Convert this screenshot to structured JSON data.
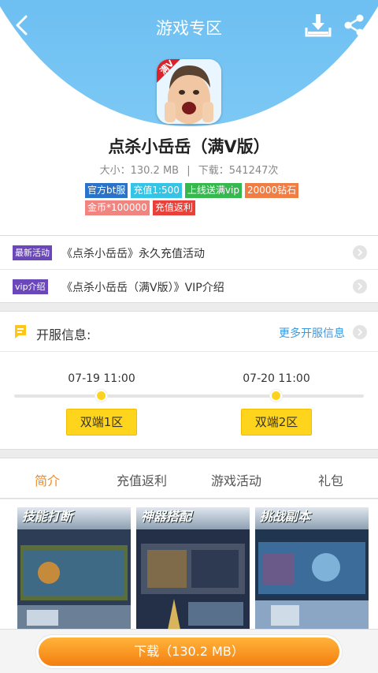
{
  "topbar": {
    "title": "游戏专区"
  },
  "app": {
    "name": "点杀小岳岳（满V版）",
    "size_text": "大小：130.2 MB",
    "separator": "|",
    "downloads_text": "下载：541247次",
    "icon_badge": "满V",
    "tags": [
      {
        "label": "官方bt服",
        "color": "#2a73c9"
      },
      {
        "label": "充值1:500",
        "color": "#35c3e6"
      },
      {
        "label": "上线送满vip",
        "color": "#35b84d"
      },
      {
        "label": "20000钻石",
        "color": "#f07d43"
      },
      {
        "label": "金币*100000",
        "color": "#f2847f"
      },
      {
        "label": "充值返利",
        "color": "#e8413a"
      }
    ]
  },
  "activities": [
    {
      "badge": "最新活动",
      "text": "《点杀小岳岳》永久充值活动"
    },
    {
      "badge": "vip介绍",
      "text": "《点杀小岳岳（满V版）》VIP介绍"
    }
  ],
  "server": {
    "title": "开服信息:",
    "more": "更多开服信息",
    "entries": [
      {
        "time": "07-19 11:00",
        "name": "双端1区"
      },
      {
        "time": "07-20 11:00",
        "name": "双端2区"
      }
    ]
  },
  "tabs": [
    "简介",
    "充值返利",
    "游戏活动",
    "礼包"
  ],
  "screenshots": [
    {
      "caption": "技能打断"
    },
    {
      "caption": "神器搭配"
    },
    {
      "caption": "挑战副本"
    }
  ],
  "download_button": "下载（130.2 MB）",
  "colors": {
    "accent": "#f38a1a",
    "header": "#37a0e6",
    "link": "#3d9ae0",
    "server_button": "#ffd41c"
  }
}
